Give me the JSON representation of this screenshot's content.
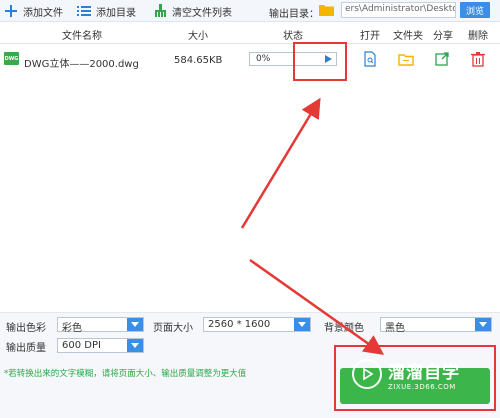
{
  "toolbar": {
    "add_file": "添加文件",
    "add_dir": "添加目录",
    "clear_list": "清空文件列表",
    "output_dir_label": "输出目录：",
    "output_path": "ers\\Administrator\\Desktop",
    "browse": "浏览"
  },
  "header": {
    "name": "文件名称",
    "size": "大小",
    "status": "状态",
    "open": "打开",
    "folder": "文件夹",
    "share": "分享",
    "delete": "删除"
  },
  "file": {
    "icon_text": "DWG",
    "name": "DWG立体——2000.dwg",
    "size": "584.65KB",
    "progress_text": "0%",
    "progress": 0
  },
  "settings": {
    "color_label": "输出色彩",
    "color_value": "彩色",
    "page_size_label": "页面大小",
    "page_size_value": "2560 * 1600",
    "bg_label": "背景颜色",
    "bg_value": "黑色",
    "quality_label": "输出质量",
    "quality_value": "600 DPI",
    "hint": "*若转换出来的文字模糊，请将页面大小、输出质量调整为更大值"
  },
  "watermark": {
    "title": "溜溜自学",
    "subtitle": "ZIXUE.3D66.COM"
  },
  "colors": {
    "accent": "#3a8ee6",
    "green": "#3cb54a",
    "annotation": "#e53935"
  }
}
